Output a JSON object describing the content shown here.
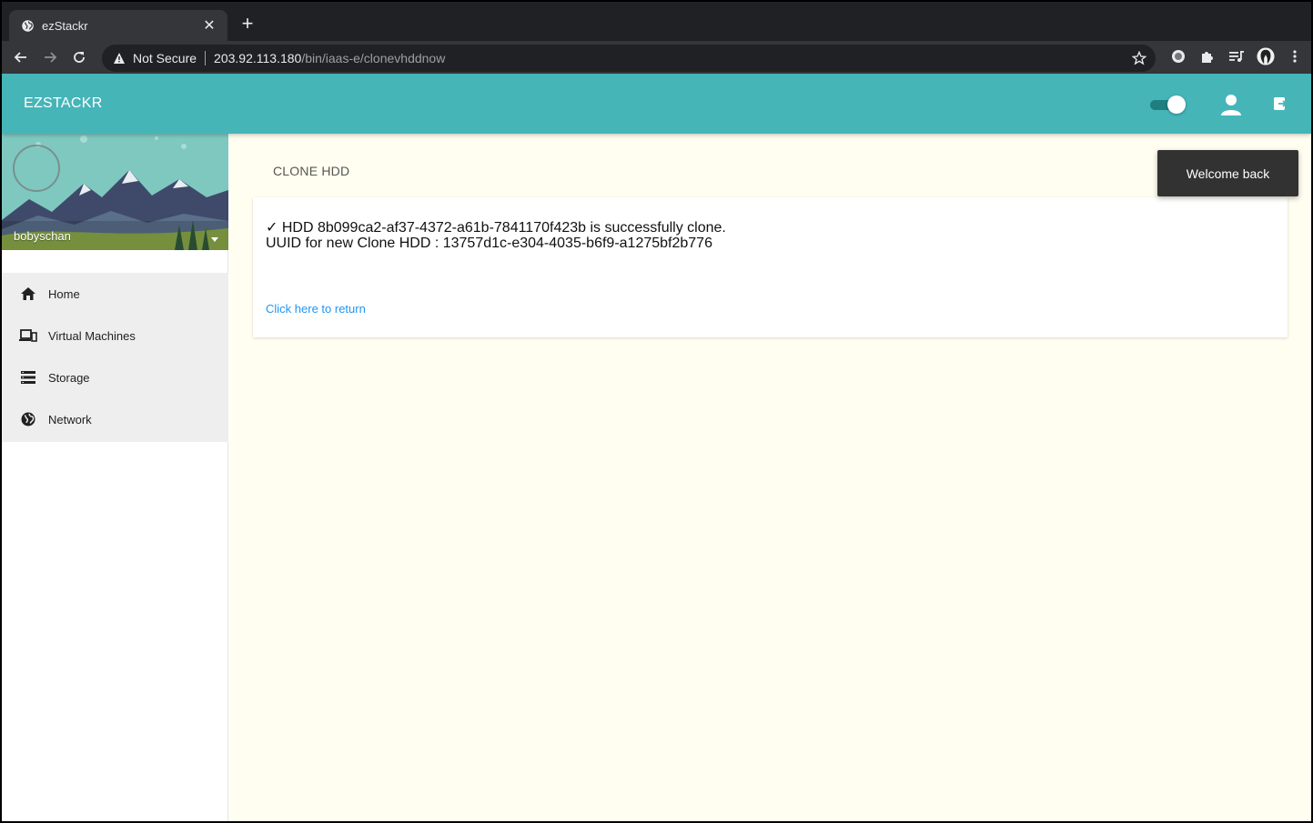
{
  "browser": {
    "tab": {
      "title": "ezStackr",
      "favicon": "globe-icon"
    },
    "url": {
      "security_label": "Not Secure",
      "host": "203.92.113.180",
      "path": "/bin/iaas-e/clonevhddnow"
    }
  },
  "appbar": {
    "brand": "EZSTACKR"
  },
  "sidebar": {
    "username": "bobyschan",
    "items": [
      {
        "label": "Home",
        "icon": "home-icon"
      },
      {
        "label": "Virtual Machines",
        "icon": "devices-icon"
      },
      {
        "label": "Storage",
        "icon": "storage-icon"
      },
      {
        "label": "Network",
        "icon": "globe-icon"
      }
    ]
  },
  "main": {
    "title": "CLONE HDD",
    "message_line1": "✓ HDD 8b099ca2-af37-4372-a61b-7841170f423b is successfully clone.",
    "message_line2": "UUID for new Clone HDD : 13757d1c-e304-4035-b6f9-a1275bf2b776",
    "return_link": "Click here to return"
  },
  "toast": {
    "text": "Welcome back"
  },
  "colors": {
    "appbar": "#45b5b8",
    "link": "#2196f3",
    "main_bg": "#fffef0"
  }
}
